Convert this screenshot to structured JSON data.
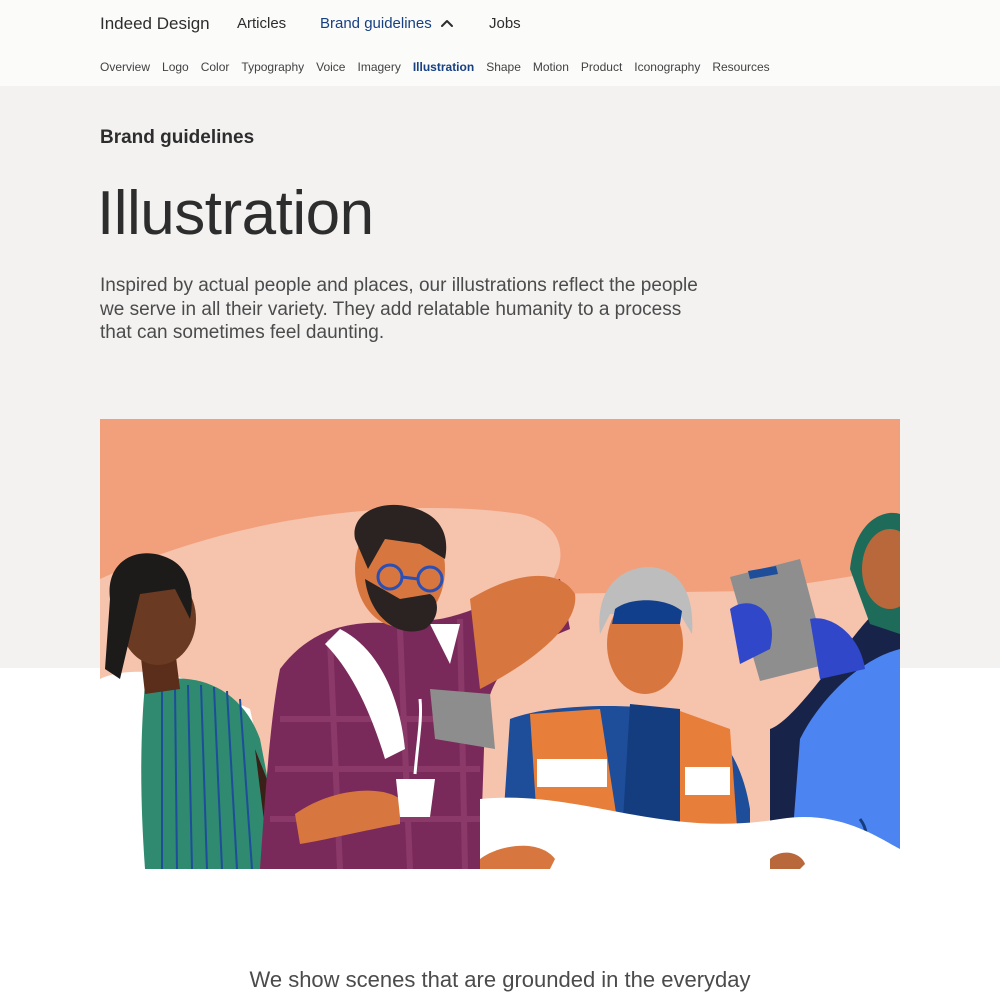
{
  "header": {
    "brand": "Indeed Design",
    "nav": [
      {
        "label": "Articles"
      },
      {
        "label": "Brand guidelines"
      },
      {
        "label": "Jobs"
      }
    ],
    "active_color": "#164081"
  },
  "subnav": {
    "items": [
      "Overview",
      "Logo",
      "Color",
      "Typography",
      "Voice",
      "Imagery",
      "Illustration",
      "Shape",
      "Motion",
      "Product",
      "Iconography",
      "Resources"
    ],
    "active": "Illustration"
  },
  "hero": {
    "eyebrow": "Brand guidelines",
    "title": "Illustration",
    "lead": "Inspired by actual people and places, our illustrations reflect the people we serve in all their variety. They add relatable humanity to a process that can sometimes feel daunting."
  },
  "illustration": {
    "background_color": "#f2a07c",
    "accent_color": "#f7c6b2"
  },
  "body": {
    "intro": "We show scenes that are grounded in the everyday"
  }
}
